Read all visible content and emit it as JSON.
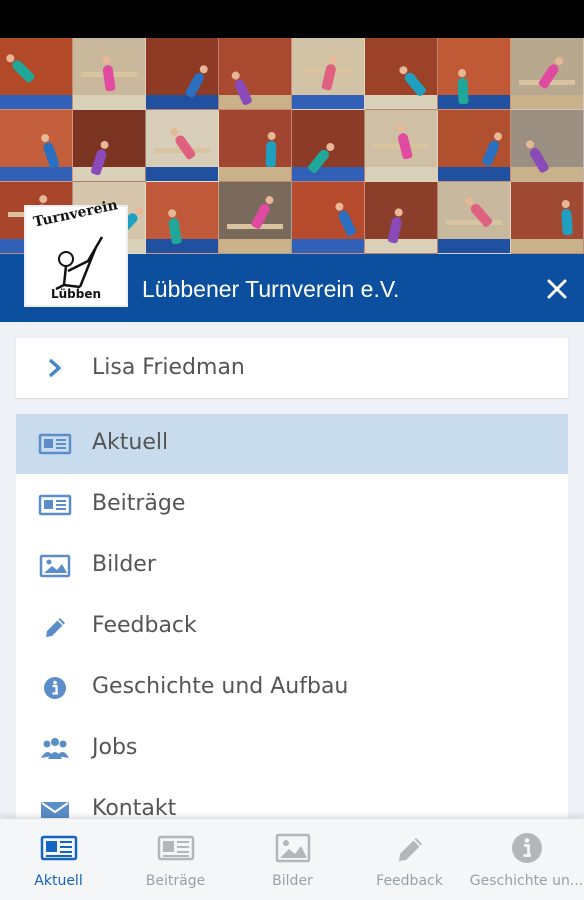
{
  "header": {
    "title": "Lübbener Turnverein e.V.",
    "logo_top_text": "Turnverein",
    "logo_bottom_text": "Lübben",
    "close_icon": "close-icon"
  },
  "user": {
    "name": "Lisa Friedman",
    "icon": "chevron-right-icon"
  },
  "menu": {
    "items": [
      {
        "label": "Aktuell",
        "icon": "news-icon",
        "active": true
      },
      {
        "label": "Beiträge",
        "icon": "news-icon",
        "active": false
      },
      {
        "label": "Bilder",
        "icon": "image-icon",
        "active": false
      },
      {
        "label": "Feedback",
        "icon": "pencil-icon",
        "active": false
      },
      {
        "label": "Geschichte und Aufbau",
        "icon": "info-icon",
        "active": false
      },
      {
        "label": "Jobs",
        "icon": "people-icon",
        "active": false
      },
      {
        "label": "Kontakt",
        "icon": "envelope-icon",
        "active": false
      }
    ]
  },
  "bottom_nav": {
    "tabs": [
      {
        "label": "Aktuell",
        "icon": "news-icon",
        "active": true
      },
      {
        "label": "Beiträge",
        "icon": "news-icon",
        "active": false
      },
      {
        "label": "Bilder",
        "icon": "image-icon",
        "active": false
      },
      {
        "label": "Feedback",
        "icon": "pencil-icon",
        "active": false
      },
      {
        "label": "Geschichte un...",
        "icon": "info-icon",
        "active": false
      }
    ]
  },
  "colors": {
    "title_bar": "#0b4f9e",
    "accent": "#1565c0",
    "icon": "#5b8ec9",
    "active_row": "#c9dcee",
    "tab_icon_inactive": "#b3b7bc"
  }
}
